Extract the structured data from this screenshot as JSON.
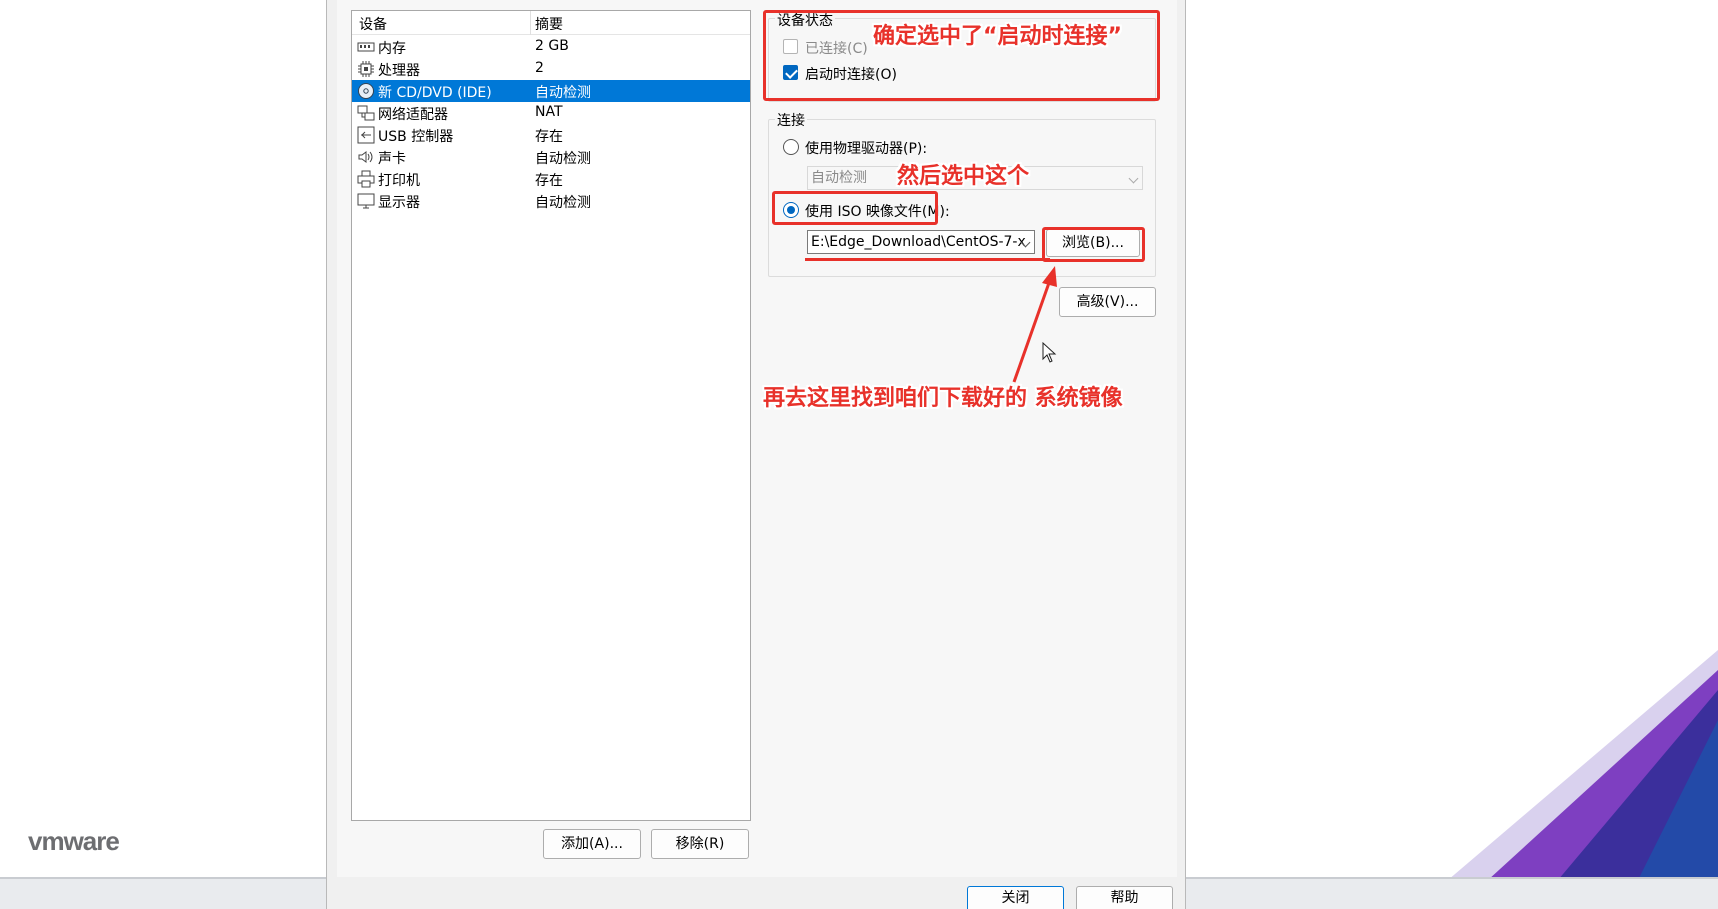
{
  "device_list": {
    "header": {
      "device": "设备",
      "summary": "摘要"
    },
    "rows": [
      {
        "label": "内存",
        "value": "2 GB",
        "icon": "memory-icon"
      },
      {
        "label": "处理器",
        "value": "2",
        "icon": "processor-icon"
      },
      {
        "label": "新 CD/DVD (IDE)",
        "value": "自动检测",
        "icon": "cd-dvd-icon",
        "selected": true
      },
      {
        "label": "网络适配器",
        "value": "NAT",
        "icon": "network-adapter-icon"
      },
      {
        "label": "USB 控制器",
        "value": "存在",
        "icon": "usb-icon"
      },
      {
        "label": "声卡",
        "value": "自动检测",
        "icon": "speaker-icon"
      },
      {
        "label": "打印机",
        "value": "存在",
        "icon": "printer-icon"
      },
      {
        "label": "显示器",
        "value": "自动检测",
        "icon": "monitor-icon"
      }
    ],
    "add_button": "添加(A)...",
    "remove_button": "移除(R)"
  },
  "device_status": {
    "title": "设备状态",
    "connected": {
      "label": "已连接(C)",
      "checked": false,
      "disabled": true
    },
    "connect_at_power_on": {
      "label": "启动时连接(O)",
      "checked": true
    }
  },
  "connection": {
    "title": "连接",
    "physical_drive": {
      "label": "使用物理驱动器(P):",
      "selected": false,
      "select_value": "自动检测"
    },
    "iso_image": {
      "label": "使用 ISO 映像文件(M):",
      "selected": true,
      "path": "E:\\Edge_Download\\CentOS-7-x",
      "browse_button": "浏览(B)..."
    }
  },
  "advanced_button": "高级(V)...",
  "footer": {
    "close_button": "关闭",
    "help_button": "帮助"
  },
  "brand": {
    "logo_text": "vmware"
  },
  "annotations": {
    "note_connect": "确定选中了“启动时连接”",
    "note_select": "然后选中这个",
    "note_browse": "再去这里找到咱们下载好的 系统镜像"
  },
  "colors": {
    "accent": "#0078d7",
    "annotation_red": "#e8312a"
  }
}
